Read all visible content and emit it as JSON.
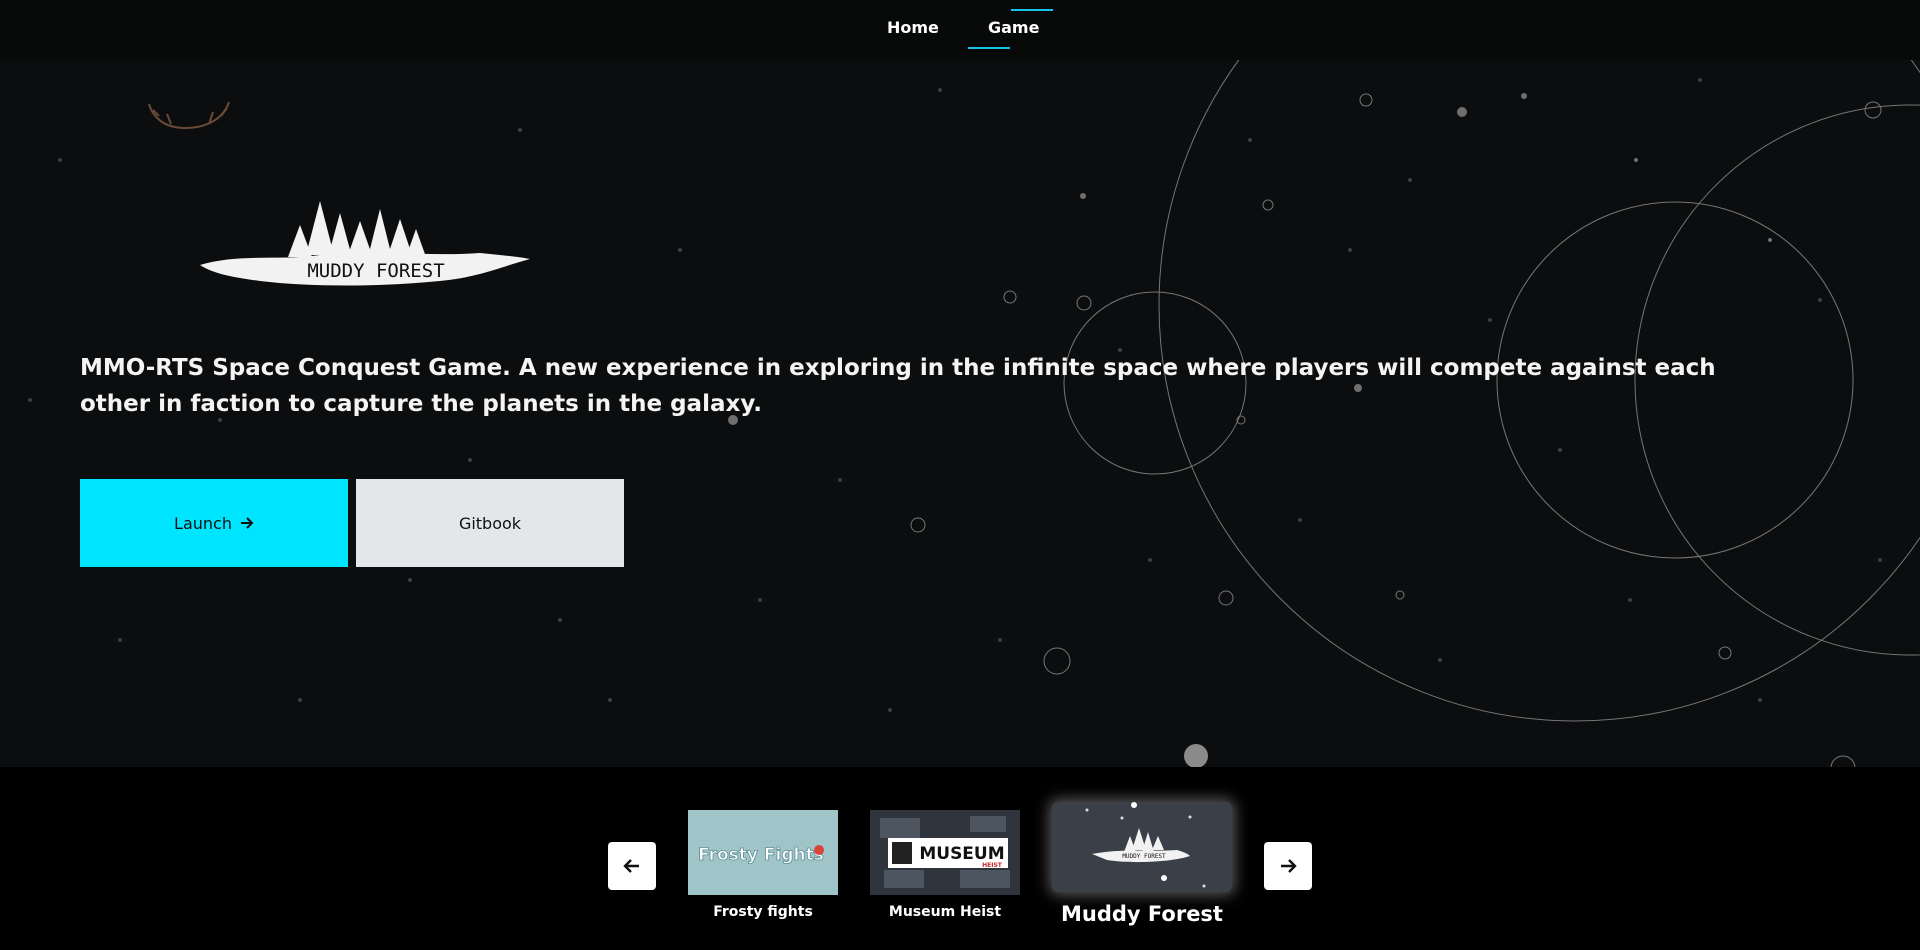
{
  "nav": {
    "home_label": "Home",
    "game_label": "Game",
    "active": "Game"
  },
  "hero": {
    "logo_text": "MUDDY FOREST",
    "description": "MMO-RTS Space Conquest Game. A new experience in exploring in the infinite space where players will compete against each other in faction to capture the planets in the galaxy.",
    "launch_label": "Launch",
    "launch_icon": "arrow-right-icon",
    "gitbook_label": "Gitbook"
  },
  "carousel": {
    "prev_icon": "arrow-left-icon",
    "next_icon": "arrow-right-icon",
    "games": [
      {
        "title": "Frosty fights",
        "thumb_text": "Frosty Fights"
      },
      {
        "title": "Museum Heist",
        "thumb_text": "MUSEUM",
        "thumb_subtext": "HEIST"
      },
      {
        "title": "Muddy Forest",
        "thumb_text": "MUDDY FOREST",
        "selected": true
      }
    ]
  },
  "colors": {
    "accent": "#00e5ff",
    "nav_accent": "#15c4e8",
    "background": "#0c0d0e",
    "secondary_button": "#e4e7e9"
  }
}
